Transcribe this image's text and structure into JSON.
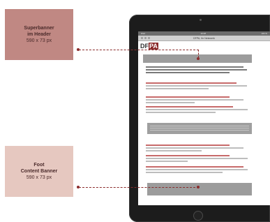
{
  "super_banner": {
    "title": "Superbanner",
    "subtitle": "im Header",
    "size": "590 x 73 px"
  },
  "foot_banner": {
    "title": "Foot",
    "subtitle": "Content Banner",
    "size": "590 x 73 px"
  },
  "screen": {
    "status_left": "iPad",
    "status_time": "10:28",
    "status_right": "100 %",
    "url_title": "DFPA, Ihr Netzwerk",
    "logo_df": "DF",
    "logo_pa": "PA"
  },
  "colors": {
    "connector": "#8b2c2c",
    "super_box": "#c08883",
    "foot_box": "#e6c8c0",
    "banner_placeholder": "#9c9c9c"
  }
}
